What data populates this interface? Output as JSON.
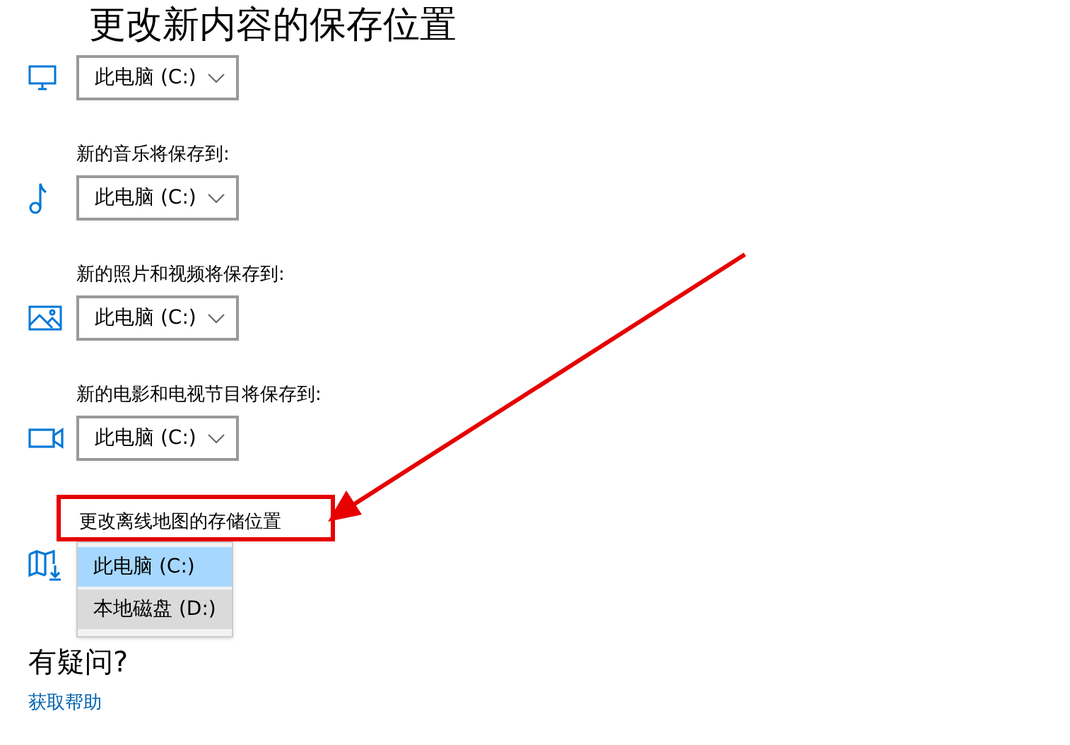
{
  "title": "更改新内容的保存位置",
  "locations": [
    {
      "kind": "desktop",
      "value": "此电脑 (C:)"
    },
    {
      "kind": "music",
      "label": "新的音乐将保存到:",
      "value": "此电脑 (C:)"
    },
    {
      "kind": "photo",
      "label": "新的照片和视频将保存到:",
      "value": "此电脑 (C:)"
    },
    {
      "kind": "video",
      "label": "新的电影和电视节目将保存到:",
      "value": "此电脑 (C:)"
    }
  ],
  "maps": {
    "label": "更改离线地图的存储位置",
    "highlighted": true,
    "options": [
      {
        "text": "此电脑 (C:)",
        "selected": true
      },
      {
        "text": "本地磁盘 (D:)",
        "selected": false
      }
    ]
  },
  "help": {
    "heading": "有疑问?",
    "link": "获取帮助"
  }
}
